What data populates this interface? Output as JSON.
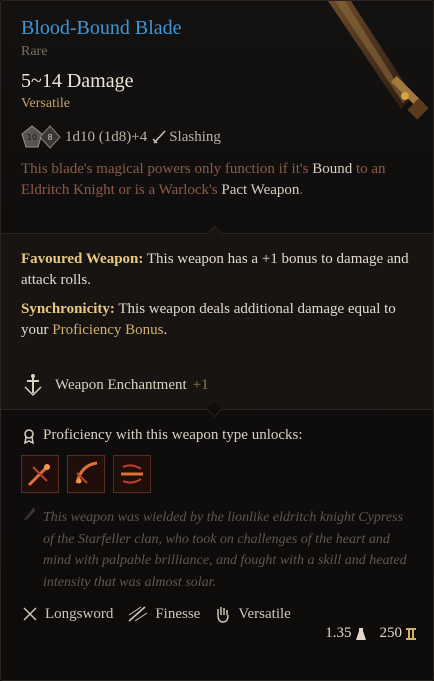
{
  "item": {
    "name": "Blood-Bound Blade",
    "rarity": "Rare",
    "damage": "5~14 Damage",
    "damage_tag": "Versatile",
    "dice_text": "1d10 (1d8)+4",
    "damage_type": "Slashing",
    "lore_pre": "This blade's magical powers only function if it's ",
    "lore_bound": "Bound",
    "lore_mid": " to an Eldritch Knight or is a Warlock's ",
    "lore_pact": "Pact Weapon",
    "lore_end": ".",
    "favoured_title": "Favoured Weapon:",
    "favoured_text": " This weapon has a +1 bonus to damage and attack rolls.",
    "sync_title": "Synchronicity:",
    "sync_text_1": " This weapon deals additional damage equal to your ",
    "sync_highlight": "Proficiency Bonus",
    "sync_text_2": ".",
    "enchant_label": "Weapon Enchantment",
    "enchant_value": "+1",
    "proficiency_heading": "Proficiency with this weapon type unlocks:",
    "unlock_icons": [
      "pommel-strike-icon",
      "lacerate-icon",
      "flourish-icon"
    ],
    "description": "This weapon was wielded by the lionlike eldritch knight Cypress of the Starfeller clan, who took on challenges of the heart and mind with palpable brilliance, and fought with a skill and heated intensity that was almost solar.",
    "properties": [
      {
        "icon": "longsword-icon",
        "label": "Longsword"
      },
      {
        "icon": "finesse-icon",
        "label": "Finesse"
      },
      {
        "icon": "versatile-hand-icon",
        "label": "Versatile"
      }
    ],
    "weight": "1.35",
    "value": "250"
  },
  "colors": {
    "rarity_rare": "#3f96d6",
    "accent_gold": "#d2b06c",
    "lore_red": "#8b5a48"
  }
}
